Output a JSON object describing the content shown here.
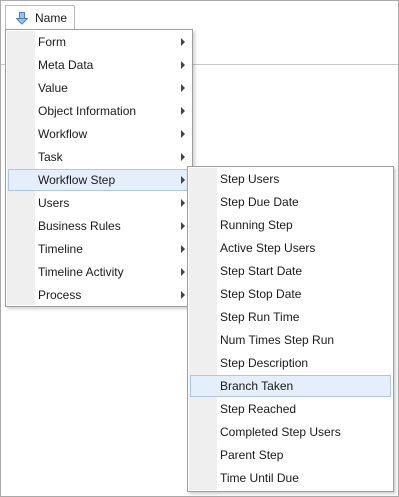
{
  "column_header": {
    "label": "Name",
    "sort_icon": "down-arrow-icon"
  },
  "main_menu": {
    "items": [
      {
        "label": "Form",
        "submenu": true,
        "highlighted": false
      },
      {
        "label": "Meta Data",
        "submenu": true,
        "highlighted": false
      },
      {
        "label": "Value",
        "submenu": true,
        "highlighted": false
      },
      {
        "label": "Object Information",
        "submenu": true,
        "highlighted": false
      },
      {
        "label": "Workflow",
        "submenu": true,
        "highlighted": false
      },
      {
        "label": "Task",
        "submenu": true,
        "highlighted": false
      },
      {
        "label": "Workflow Step",
        "submenu": true,
        "highlighted": true
      },
      {
        "label": "Users",
        "submenu": true,
        "highlighted": false
      },
      {
        "label": "Business Rules",
        "submenu": true,
        "highlighted": false
      },
      {
        "label": "Timeline",
        "submenu": true,
        "highlighted": false
      },
      {
        "label": "Timeline Activity",
        "submenu": true,
        "highlighted": false
      },
      {
        "label": "Process",
        "submenu": true,
        "highlighted": false
      }
    ]
  },
  "submenu": {
    "items": [
      {
        "label": "Step Users",
        "highlighted": false
      },
      {
        "label": "Step Due Date",
        "highlighted": false
      },
      {
        "label": "Running Step",
        "highlighted": false
      },
      {
        "label": "Active Step Users",
        "highlighted": false
      },
      {
        "label": "Step Start Date",
        "highlighted": false
      },
      {
        "label": "Step Stop Date",
        "highlighted": false
      },
      {
        "label": "Step Run Time",
        "highlighted": false
      },
      {
        "label": "Num Times Step Run",
        "highlighted": false
      },
      {
        "label": "Step Description",
        "highlighted": false
      },
      {
        "label": "Branch Taken",
        "highlighted": true
      },
      {
        "label": "Step Reached",
        "highlighted": false
      },
      {
        "label": "Completed Step Users",
        "highlighted": false
      },
      {
        "label": "Parent Step",
        "highlighted": false
      },
      {
        "label": "Time Until Due",
        "highlighted": false
      }
    ]
  },
  "colors": {
    "highlight_bg": "#e5effb",
    "highlight_border": "#a8c8ec",
    "sort_arrow": "#4a7fc8",
    "gutter": "#efefef"
  }
}
